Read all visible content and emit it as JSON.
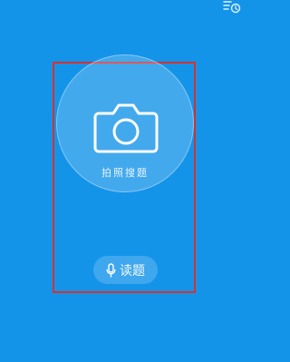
{
  "icons": {
    "top_right": "history-icon",
    "camera": "camera-icon",
    "mic": "mic-icon"
  },
  "colors": {
    "background": "#1494e9",
    "highlight": "#d9302f"
  },
  "main": {
    "camera_label": "拍照搜题",
    "read_label": "读题"
  }
}
